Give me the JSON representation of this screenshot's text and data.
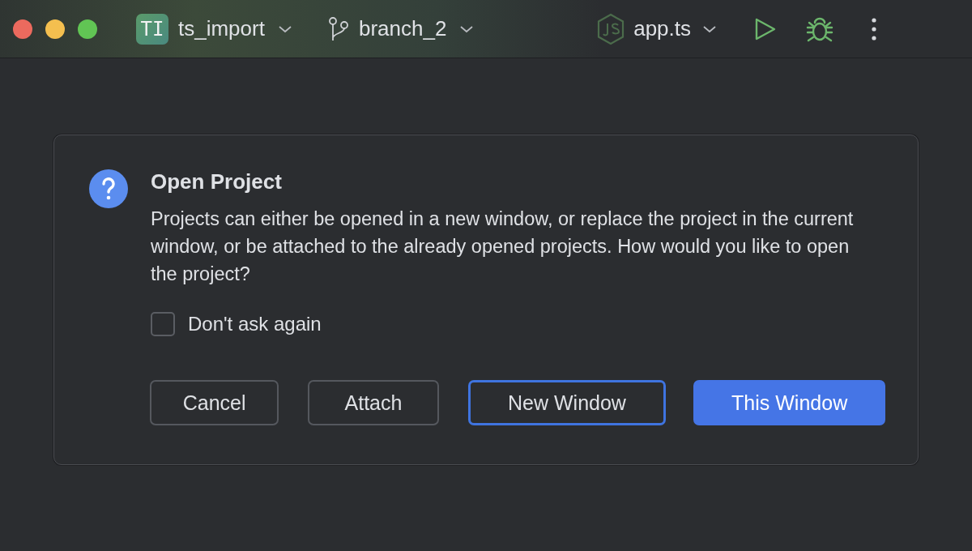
{
  "toolbar": {
    "project_badge": "TI",
    "project": "ts_import",
    "branch": "branch_2",
    "run_config": "app.ts"
  },
  "dialog": {
    "title": "Open Project",
    "message": "Projects can either be opened in a new window, or replace the project in the current window, or be attached to the already opened projects. How would you like to open the project?",
    "dont_ask": {
      "label": "Don't ask again",
      "checked": false
    },
    "buttons": [
      {
        "label": "Cancel",
        "kind": "default",
        "focused": false
      },
      {
        "label": "Attach",
        "kind": "default",
        "focused": false
      },
      {
        "label": "New Window",
        "kind": "default",
        "focused": true
      },
      {
        "label": "This Window",
        "kind": "primary",
        "focused": false
      }
    ]
  }
}
